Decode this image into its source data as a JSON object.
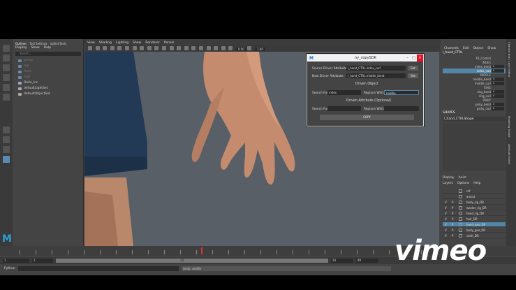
{
  "outliner": {
    "tabs": [
      "Outliner",
      "Tool Settings",
      "ngSkinTools"
    ],
    "menu": [
      "Display",
      "Show",
      "Help"
    ],
    "search_placeholder": "Search...",
    "items": [
      {
        "label": "persp",
        "dim": true
      },
      {
        "label": "top",
        "dim": true
      },
      {
        "label": "front",
        "dim": true
      },
      {
        "label": "side",
        "dim": true
      },
      {
        "label": "Della_Inc",
        "dim": false
      },
      {
        "label": "defaultLightSet",
        "dim": false
      },
      {
        "label": "defaultObjectSet",
        "dim": false
      }
    ]
  },
  "viewport": {
    "menu": [
      "View",
      "Shading",
      "Lighting",
      "Show",
      "Renderer",
      "Panels"
    ],
    "value1": "0.00",
    "value2": "1.00"
  },
  "channels": {
    "menu": [
      "Channels",
      "Edit",
      "Object",
      "Show"
    ],
    "node": "l_hand_CTRL",
    "attributes": [
      {
        "name": "FK_Control",
        "value": "",
        "header": false,
        "selected": false
      },
      {
        "name": "INDEX",
        "value": "",
        "header": true,
        "selected": false
      },
      {
        "name": "index_bend",
        "value": "0",
        "header": false,
        "selected": false
      },
      {
        "name": "index_curl",
        "value": "0",
        "header": false,
        "selected": true
      },
      {
        "name": "MIDDLE",
        "value": "",
        "header": true,
        "selected": false
      },
      {
        "name": "middle_bend",
        "value": "0",
        "header": false,
        "selected": false
      },
      {
        "name": "middle_curl",
        "value": "0",
        "header": false,
        "selected": false
      },
      {
        "name": "RING",
        "value": "",
        "header": true,
        "selected": false
      },
      {
        "name": "ring_bend",
        "value": "0",
        "header": false,
        "selected": false
      },
      {
        "name": "ring_curl",
        "value": "0",
        "header": false,
        "selected": false
      },
      {
        "name": "PINKY",
        "value": "",
        "header": true,
        "selected": false
      },
      {
        "name": "pinky_bend",
        "value": "0",
        "header": false,
        "selected": false
      },
      {
        "name": "pinky_curl",
        "value": "0",
        "header": false,
        "selected": false
      }
    ],
    "shapes_label": "SHAPES",
    "shape_node": "l_hand_CTRLShape"
  },
  "side_tabs": [
    "Channel Box / Layer Editor",
    "Modeling Toolkit",
    "Attribute Editor"
  ],
  "layers": {
    "tabs": [
      "Display",
      "Anim"
    ],
    "menu": [
      "Layers",
      "Options",
      "Help"
    ],
    "rows": [
      {
        "v": "",
        "p": "",
        "name": "ref",
        "selected": false
      },
      {
        "v": "",
        "p": "",
        "name": "anicat",
        "selected": false
      },
      {
        "v": "V",
        "p": "P",
        "name": "body_rig_DR",
        "selected": false
      },
      {
        "v": "V",
        "p": "P",
        "name": "waster_rig_DR",
        "selected": false
      },
      {
        "v": "V",
        "p": "P",
        "name": "head_rig_DR",
        "selected": false
      },
      {
        "v": "V",
        "p": "P",
        "name": "hair_DR",
        "selected": false
      },
      {
        "v": "V",
        "p": "P",
        "name": "hand_geo_DR",
        "selected": true
      },
      {
        "v": "V",
        "p": "P",
        "name": "body_geo_DR",
        "selected": false
      },
      {
        "v": "V",
        "p": "P",
        "name": "cloth_DR",
        "selected": false
      }
    ]
  },
  "range": {
    "start": "1",
    "start2": "1",
    "current": "24",
    "end": "24",
    "end2": "40"
  },
  "command": {
    "label": "Python",
    "result": "Undo: setAttr"
  },
  "dialog": {
    "title": "ny_copySDK",
    "logo": "M",
    "minimize": "–",
    "maximize": "□",
    "close": "✕",
    "source_label": "Source Driver Attribute:",
    "source_value": "l_hand_CTRL.index_curl",
    "new_label": "New Driver Attribute:",
    "new_value": "l_hand_CTRL.middle_bend",
    "set_label": "Set",
    "driven_heading": "Driven Object",
    "search_label": "Search For:",
    "search_value": "index",
    "replace_label": "Replace With:",
    "replace_value": "middle",
    "driven_attr_heading": "Driven Attribute (Optional)",
    "search2_value": "",
    "replace2_value": "",
    "copy_label": "COPY"
  },
  "watermark": "vimeo"
}
